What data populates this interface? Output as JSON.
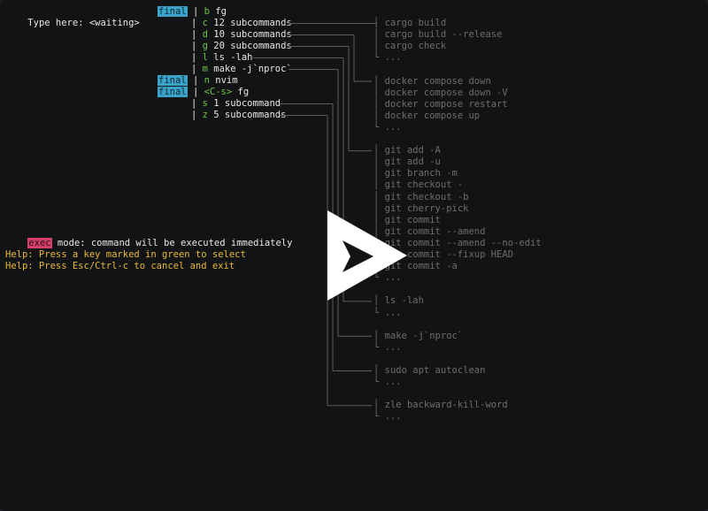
{
  "prompt": {
    "label": "Type here:",
    "value": "<waiting>"
  },
  "badge_final": "final",
  "menu": [
    {
      "badge": true,
      "key": "b",
      "text": "fg"
    },
    {
      "badge": false,
      "key": "c",
      "text": "12 subcommands"
    },
    {
      "badge": false,
      "key": "d",
      "text": "10 subcommands"
    },
    {
      "badge": false,
      "key": "g",
      "text": "20 subcommands"
    },
    {
      "badge": false,
      "key": "l",
      "text": "ls -lah"
    },
    {
      "badge": false,
      "key": "m",
      "text": "make -j`nproc`"
    },
    {
      "badge": true,
      "key": "n",
      "text": "nvim"
    },
    {
      "badge": true,
      "key": "<C-s>",
      "text": "fg"
    },
    {
      "badge": false,
      "key": "s",
      "text": "1 subcommand"
    },
    {
      "badge": false,
      "key": "z",
      "text": "5 subcommands"
    }
  ],
  "mode": {
    "badge": "exec",
    "text": "mode: command will be executed immediately"
  },
  "help": [
    "Help: Press a key marked in green to select",
    "Help: Press Esc/Ctrl-c to cancel and exit"
  ],
  "groups": [
    [
      "cargo build",
      "cargo build --release",
      "cargo check",
      "..."
    ],
    [
      "docker compose down",
      "docker compose down -V",
      "docker compose restart",
      "docker compose up",
      "..."
    ],
    [
      "git add -A",
      "git add -u",
      "git branch -m",
      "git checkout -",
      "git checkout -b",
      "git cherry-pick",
      "git commit",
      "git commit --amend",
      "git commit --amend --no-edit",
      "git commit --fixup HEAD",
      "git commit -a",
      "..."
    ],
    [
      "ls -lah",
      "..."
    ],
    [
      "make -j`nproc`",
      "..."
    ],
    [
      "sudo apt autoclean",
      "..."
    ],
    [
      "zle backward-kill-word",
      "..."
    ]
  ],
  "colors": {
    "accent": "#3aa3c9",
    "exec": "#d6406c",
    "key": "#6cc644",
    "help": "#e8b93c",
    "connector": "#5a5d60"
  },
  "overlay_icon": "play-icon"
}
